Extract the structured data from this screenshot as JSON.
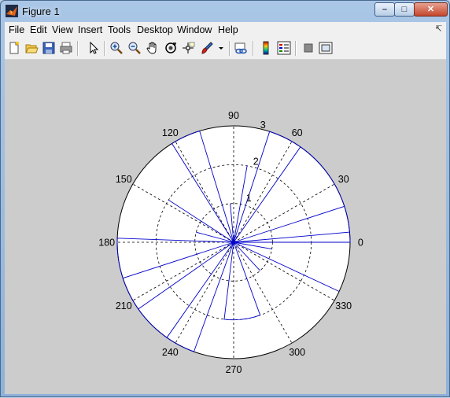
{
  "window": {
    "title": "Figure 1",
    "controls": [
      "minimize",
      "maximize",
      "close"
    ]
  },
  "menu": [
    "File",
    "Edit",
    "View",
    "Insert",
    "Tools",
    "Desktop",
    "Window",
    "Help"
  ],
  "toolbar": [
    "new-figure-icon",
    "open-file-icon",
    "save-icon",
    "print-icon",
    "edit-plot-arrow-icon",
    "zoom-in-icon",
    "zoom-out-icon",
    "pan-hand-icon",
    "rotate-3d-icon",
    "data-cursor-icon",
    "brush-icon",
    "link-plot-icon",
    "colorbar-icon",
    "legend-icon",
    "hide-plot-tools-icon",
    "show-plot-tools-icon"
  ],
  "colors": {
    "grid": "#000000",
    "data": "#0000cc",
    "figure_bg": "#cccccc",
    "axes_bg": "#ffffff"
  },
  "chart_data": {
    "type": "polar",
    "title": "",
    "angle_ticks": [
      "0",
      "30",
      "60",
      "90",
      "120",
      "150",
      "180",
      "210",
      "240",
      "270",
      "300",
      "330"
    ],
    "radius_ticks": [
      "1",
      "2",
      "3"
    ],
    "rlim": [
      0,
      3
    ],
    "grid": true,
    "series": [
      {
        "values": [
          {
            "theta": 0,
            "r": 3
          },
          {
            "theta": 5,
            "r": 3
          },
          {
            "theta": 18,
            "r": 3
          },
          {
            "theta": 55,
            "r": 3
          },
          {
            "theta": 72,
            "r": 3
          },
          {
            "theta": 80,
            "r": 2
          },
          {
            "theta": 95,
            "r": 1
          },
          {
            "theta": 107,
            "r": 3
          },
          {
            "theta": 122,
            "r": 3
          },
          {
            "theta": 147,
            "r": 2
          },
          {
            "theta": 165,
            "r": 1
          },
          {
            "theta": 178,
            "r": 3
          },
          {
            "theta": 198,
            "r": 3
          },
          {
            "theta": 215,
            "r": 3
          },
          {
            "theta": 235,
            "r": 3
          },
          {
            "theta": 250,
            "r": 3
          },
          {
            "theta": 263,
            "r": 2
          },
          {
            "theta": 290,
            "r": 2
          },
          {
            "theta": 313,
            "r": 1
          },
          {
            "theta": 335,
            "r": 3
          },
          {
            "theta": 350,
            "r": 1
          }
        ]
      }
    ]
  }
}
